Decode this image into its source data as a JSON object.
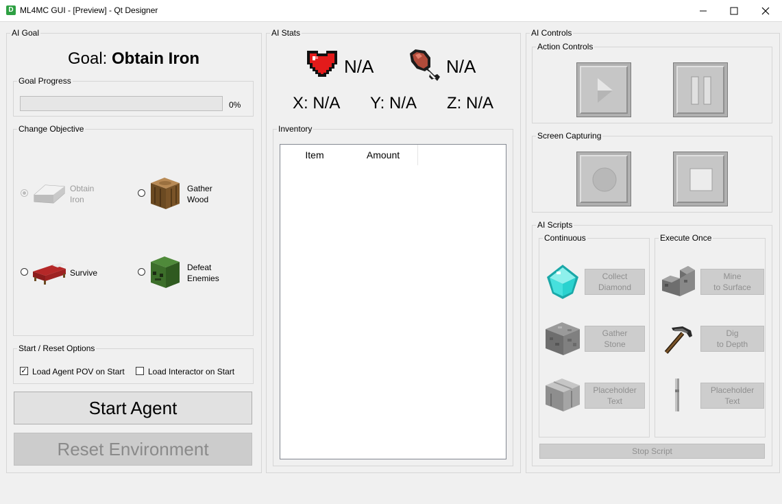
{
  "window": {
    "app_icon": "D",
    "title": "ML4MC GUI - [Preview] - Qt Designer",
    "minimize_icon": "minimize-icon",
    "maximize_icon": "maximize-icon",
    "close_icon": "close-icon"
  },
  "ai_goal": {
    "group_title": "AI Goal",
    "goal_prefix": "Goal: ",
    "goal_value": "Obtain Iron",
    "progress_group_title": "Goal Progress",
    "progress_value": 0,
    "progress_text": "0%",
    "objective_group_title": "Change Objective",
    "objectives": [
      {
        "line1": "Obtain",
        "line2": "Iron",
        "selected": true,
        "enabled": false,
        "icon": "iron-ingot-icon"
      },
      {
        "line1": "Gather",
        "line2": "Wood",
        "selected": false,
        "enabled": true,
        "icon": "wood-log-icon"
      },
      {
        "line1": "Survive",
        "line2": "",
        "selected": false,
        "enabled": true,
        "icon": "bed-icon"
      },
      {
        "line1": "Defeat",
        "line2": "Enemies",
        "selected": false,
        "enabled": true,
        "icon": "zombie-head-icon"
      }
    ],
    "start_reset_group_title": "Start / Reset Options",
    "load_agent_pov_label": "Load Agent POV on Start",
    "load_agent_pov_checked": true,
    "load_interactor_label": "Load Interactor on Start",
    "load_interactor_checked": false,
    "start_button_label": "Start Agent",
    "reset_button_label": "Reset Environment"
  },
  "ai_stats": {
    "group_title": "AI Stats",
    "health_icon": "heart-icon",
    "health_value": "N/A",
    "hunger_icon": "drumstick-icon",
    "hunger_value": "N/A",
    "x_text": "X: N/A",
    "y_text": "Y: N/A",
    "z_text": "Z: N/A",
    "inventory_group_title": "Inventory",
    "inventory_columns": [
      "Item",
      "Amount"
    ]
  },
  "ai_controls": {
    "group_title": "AI Controls",
    "action_group_title": "Action Controls",
    "play_icon": "play-icon",
    "pause_icon": "pause-icon",
    "capture_group_title": "Screen Capturing",
    "record_icon": "record-icon",
    "stop_icon": "stop-icon",
    "scripts_group_title": "AI Scripts",
    "continuous_title": "Continuous",
    "execute_once_title": "Execute Once",
    "continuous_scripts": [
      {
        "line1": "Collect",
        "line2": "Diamond",
        "icon": "diamond-icon"
      },
      {
        "line1": "Gather",
        "line2": "Stone",
        "icon": "stone-block-icon"
      },
      {
        "line1": "Placeholder",
        "line2": "Text",
        "icon": "crafting-table-icon"
      }
    ],
    "once_scripts": [
      {
        "line1": "Mine",
        "line2": "to Surface",
        "icon": "stone-stairs-icon"
      },
      {
        "line1": "Dig",
        "line2": "to Depth",
        "icon": "pickaxe-icon"
      },
      {
        "line1": "Placeholder",
        "line2": "Text",
        "icon": "stick-icon"
      }
    ],
    "stop_script_label": "Stop Script"
  }
}
